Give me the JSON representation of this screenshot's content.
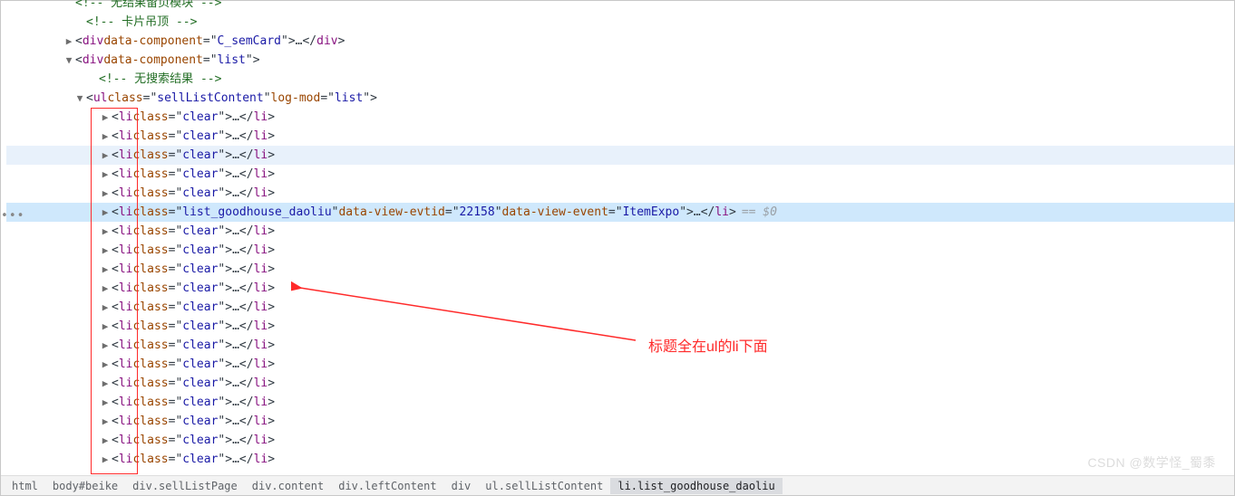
{
  "comments": {
    "top_partial": "<!-- 无结果留页模块 -->",
    "card_hang": "卡片吊顶",
    "no_search": "无搜索结果"
  },
  "divs": {
    "sem_attr": "data-component",
    "sem_val": "C_semCard",
    "list_attr": "data-component",
    "list_val": "list"
  },
  "ul": {
    "class_attr": "class",
    "class_val": "sellListContent",
    "log_attr": "log-mod",
    "log_val": "list"
  },
  "li_clear": {
    "class_attr": "class",
    "class_val": "clear"
  },
  "li_goodhouse": {
    "class_attr": "class",
    "class_val": "list_goodhouse_daoliu  ",
    "evtid_attr": "data-view-evtid",
    "evtid_val": "22158",
    "evt_attr": "data-view-event",
    "evt_val": "ItemExpo",
    "dollar": "== $0"
  },
  "annotation": "标题全在ul的li下面",
  "watermark": "CSDN @数学怪_蜀黍",
  "breadcrumbs": [
    "html",
    "body#beike",
    "div.sellListPage",
    "div.content",
    "div.leftContent",
    "div",
    "ul.sellListContent",
    "li.list_goodhouse_daoliu"
  ],
  "li_rows": [
    {
      "type": "clear"
    },
    {
      "type": "clear"
    },
    {
      "type": "clear",
      "hl": true
    },
    {
      "type": "clear"
    },
    {
      "type": "clear"
    },
    {
      "type": "goodhouse",
      "sel": true
    },
    {
      "type": "clear"
    },
    {
      "type": "clear"
    },
    {
      "type": "clear"
    },
    {
      "type": "clear"
    },
    {
      "type": "clear"
    },
    {
      "type": "clear"
    },
    {
      "type": "clear"
    },
    {
      "type": "clear"
    },
    {
      "type": "clear"
    },
    {
      "type": "clear"
    },
    {
      "type": "clear"
    },
    {
      "type": "clear"
    },
    {
      "type": "clear"
    }
  ],
  "indents": {
    "base": 64,
    "div": 76,
    "comment2": 90,
    "ul": 90,
    "li": 104
  }
}
